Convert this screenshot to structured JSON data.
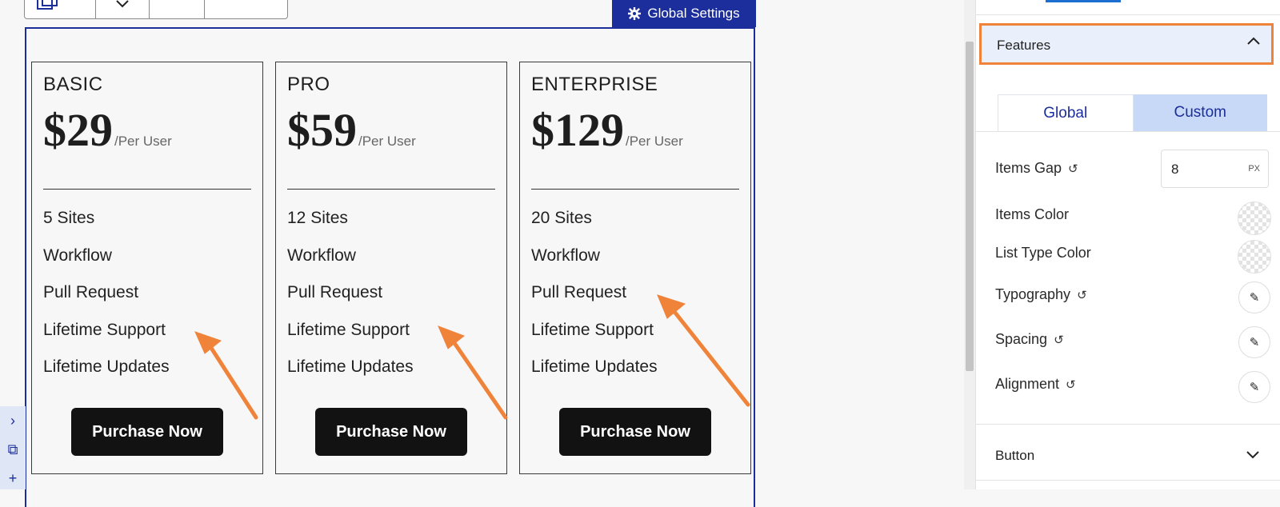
{
  "toolbar": {
    "global_settings_label": "Global Settings"
  },
  "pricing": {
    "per_label": "/Per User",
    "button_label": "Purchase Now",
    "plans": [
      {
        "name": "BASIC",
        "price": "$29",
        "features": [
          "5 Sites",
          "Workflow",
          "Pull Request",
          "Lifetime Support",
          "Lifetime Updates"
        ]
      },
      {
        "name": "PRO",
        "price": "$59",
        "features": [
          "12 Sites",
          "Workflow",
          "Pull Request",
          "Lifetime Support",
          "Lifetime Updates"
        ]
      },
      {
        "name": "ENTERPRISE",
        "price": "$129",
        "features": [
          "20 Sites",
          "Workflow",
          "Pull Request",
          "Lifetime Support",
          "Lifetime Updates"
        ]
      }
    ]
  },
  "panel": {
    "features_section_label": "Features",
    "tabs": {
      "global": "Global",
      "custom": "Custom"
    },
    "items_gap": {
      "label": "Items Gap",
      "value": "8",
      "unit": "PX"
    },
    "items_color_label": "Items Color",
    "list_type_color_label": "List Type Color",
    "typography_label": "Typography",
    "spacing_label": "Spacing",
    "alignment_label": "Alignment",
    "button_section_label": "Button"
  },
  "colors": {
    "accent_blue": "#1c2e9b",
    "highlight_orange": "#f0833a",
    "button_dark": "#121212",
    "tab_custom_bg": "#c8d9f7"
  }
}
